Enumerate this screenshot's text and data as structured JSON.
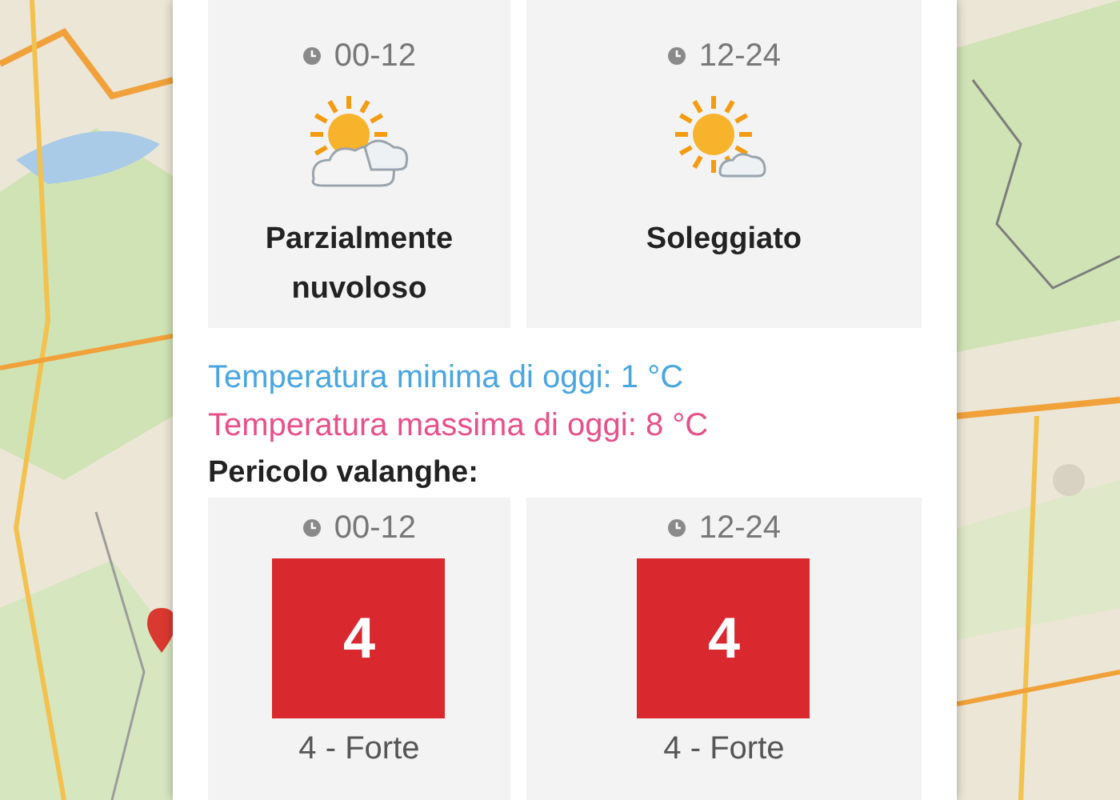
{
  "forecast": [
    {
      "period": "00-12",
      "kind": "partly_cloudy",
      "condition": "Parzialmente nuvoloso"
    },
    {
      "period": "12-24",
      "kind": "sunny",
      "condition": "Soleggiato"
    }
  ],
  "temperature_min": "Temperatura minima di oggi: 1 °C",
  "temperature_max": "Temperatura massima di oggi: 8 °C",
  "avalanche": {
    "title": "Pericolo valanghe:",
    "periods": [
      {
        "period": "00-12",
        "level_number": "4",
        "label": "4 - Forte",
        "color": "#d9282e"
      },
      {
        "period": "12-24",
        "level_number": "4",
        "label": "4 - Forte",
        "color": "#d9282e"
      }
    ]
  }
}
